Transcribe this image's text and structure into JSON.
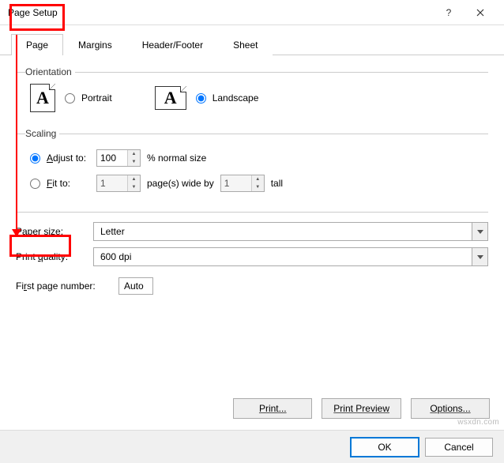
{
  "title": "Page Setup",
  "tabs": {
    "page": "Page",
    "margins": "Margins",
    "headerfooter": "Header/Footer",
    "sheet": "Sheet"
  },
  "orientation": {
    "legend": "Orientation",
    "portrait": "Portrait",
    "landscape": "Landscape",
    "glyph": "A"
  },
  "scaling": {
    "legend": "Scaling",
    "adjust_label": "Adjust to:",
    "adjust_value": "100",
    "adjust_suffix": "% normal size",
    "fit_label": "Fit to:",
    "fit_wide": "1",
    "fit_mid": "page(s) wide by",
    "fit_tall_val": "1",
    "fit_tall_suffix": "tall"
  },
  "paper": {
    "label": "Paper size:",
    "value": "Letter"
  },
  "quality": {
    "label": "Print quality:",
    "value": "600 dpi"
  },
  "firstpage": {
    "label": "First page number:",
    "value": "Auto"
  },
  "buttons": {
    "print": "Print...",
    "preview": "Print Preview",
    "options": "Options..."
  },
  "footer": {
    "ok": "OK",
    "cancel": "Cancel"
  },
  "watermark": "wsxdn.com"
}
